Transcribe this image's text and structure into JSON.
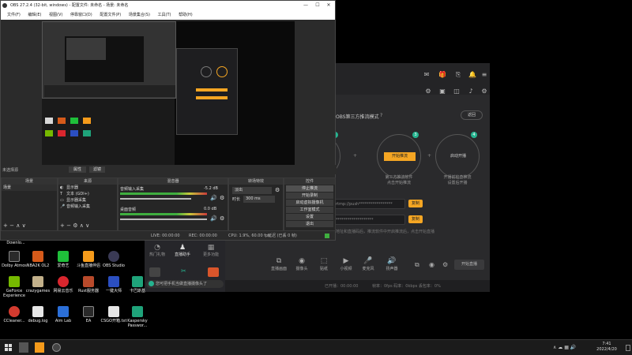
{
  "obs": {
    "title": "OBS 27.2.4 (32-bit, windows) - 配置文件: 未命名 - 场景: 未命名",
    "menu": [
      "文件(F)",
      "编辑(E)",
      "视图(V)",
      "停靠窗口(D)",
      "配置文件(P)",
      "场景集合(S)",
      "工具(T)",
      "帮助(H)"
    ],
    "no_source_selected": "未选择源",
    "props_button": "属性",
    "filters_button": "滤镜",
    "docks": {
      "scenes": "场景",
      "sources": "来源",
      "mixer": "混音器",
      "transitions": "转场特效",
      "controls": "控件"
    },
    "scene_items": [
      "场景"
    ],
    "sources": [
      {
        "icon": "◐",
        "label": "显示器"
      },
      {
        "icon": "T",
        "label": "文本 (GDI+)"
      },
      {
        "icon": "▭",
        "label": "显示器采集"
      },
      {
        "icon": "🎤",
        "label": "音频输入采集"
      }
    ],
    "mixer": [
      {
        "name": "音频输入采集",
        "db": "-5.2 dB"
      },
      {
        "name": "桌面音频",
        "db": "0.0 dB"
      }
    ],
    "transition": {
      "type": "淡出",
      "duration_label": "时长",
      "duration_value": "300 ms"
    },
    "controls": [
      "停止推流",
      "开始录制",
      "启动虚拟摄像机",
      "工作室模式",
      "设置",
      "退出"
    ],
    "status": {
      "live": "LIVE: 00:00:00",
      "rec": "REC: 00:00:00",
      "cpu": "CPU: 1.9%, 60.00 fps",
      "kbps": "kb/s: 0 kb/s",
      "dropped": "延迟 (已丢 0 帧)"
    }
  },
  "liveapp": {
    "mode_title": "OBS第三方推流模式",
    "back_button": "返回",
    "steps": [
      {
        "num": "2",
        "label": "",
        "desc": ""
      },
      {
        "num": "3",
        "label": "开始推流",
        "desc": "第三方推流软件\n点击开始推流"
      },
      {
        "num": "4",
        "label": "启动开播",
        "desc": "开播前检查推流\n设置后开播"
      }
    ],
    "fields": [
      {
        "value": "rtmp://push*****************",
        "button": "复制"
      },
      {
        "value": "*******************",
        "button": "复制"
      }
    ],
    "hint": "复制推流地址和直播码后，推流软件中开启推流后，点击开始直播",
    "tools": [
      {
        "glyph": "⧉",
        "label": "直播画面"
      },
      {
        "glyph": "◉",
        "label": "摄像头"
      },
      {
        "glyph": "⬚",
        "label": "贴纸"
      },
      {
        "glyph": "▶",
        "label": "小视频"
      },
      {
        "glyph": "🎤",
        "label": "麦克风"
      },
      {
        "glyph": "🔊",
        "label": "扬声器"
      }
    ],
    "start_button": "开始直播",
    "foot_left": "已开播：00:00:00",
    "foot_right": "帧率：0fps  码率：0kbps  丢包率：0%"
  },
  "assistant": {
    "items": [
      "热门礼物",
      "直播助手",
      "更多功能"
    ],
    "notice": "您可把手机当做直播摄像头了"
  },
  "desktop_icons": [
    {
      "label": "Downlo...",
      "color": "#d8d8d8"
    },
    {
      "label": "Dolby Atmos",
      "color": "#2a2a2a"
    },
    {
      "label": "NBA2K OL2",
      "color": "#d65a1a"
    },
    {
      "label": "爱奇艺",
      "color": "#1fbf3a"
    },
    {
      "label": "斗鱼直播伴侣",
      "color": "#f59b1b"
    },
    {
      "label": "OBS Studio",
      "color": "#3a3a55"
    },
    {
      "label": "GeForce Experience",
      "color": "#76b900"
    },
    {
      "label": "crazygames",
      "color": "#c2b08a"
    },
    {
      "label": "网易云音乐",
      "color": "#d9262e"
    },
    {
      "label": "Rust服务器",
      "color": "#b84a2b"
    },
    {
      "label": "一键大师",
      "color": "#2b4fc1"
    },
    {
      "label": "卡巴斯基",
      "color": "#1fa37a"
    },
    {
      "label": "CCleaner...",
      "color": "#d43b2f"
    },
    {
      "label": "debug.log",
      "color": "#e6e6e6"
    },
    {
      "label": "Aim Lab",
      "color": "#2b6fd8"
    },
    {
      "label": "EA",
      "color": "#2a2a2a"
    },
    {
      "label": "CSGO开箱.txt",
      "color": "#e6e6e6"
    },
    {
      "label": "Kaspersky Passwor...",
      "color": "#1fa37a"
    }
  ],
  "taskbar": {
    "time": "7:41",
    "date": "2022/4/20"
  }
}
